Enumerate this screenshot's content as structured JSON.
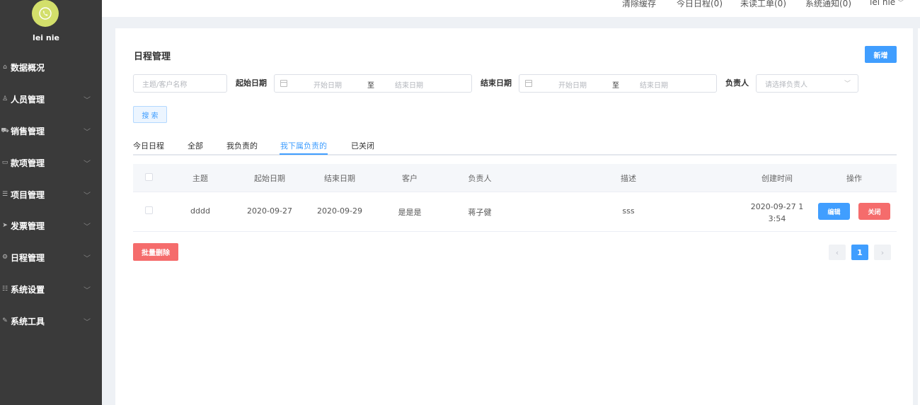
{
  "sidebar": {
    "username": "lei nie",
    "items": [
      {
        "label": "数据概况",
        "icon": "home-icon",
        "glyph": "⌂",
        "expandable": false
      },
      {
        "label": "人员管理",
        "icon": "user-icon",
        "glyph": "♙",
        "expandable": true
      },
      {
        "label": "销售管理",
        "icon": "cart-icon",
        "glyph": "⛟",
        "expandable": true
      },
      {
        "label": "款项管理",
        "icon": "money-icon",
        "glyph": "▭",
        "expandable": true
      },
      {
        "label": "项目管理",
        "icon": "database-icon",
        "glyph": "☰",
        "expandable": true
      },
      {
        "label": "发票管理",
        "icon": "send-icon",
        "glyph": "➤",
        "expandable": true
      },
      {
        "label": "日程管理",
        "icon": "gear-icon",
        "glyph": "⚙",
        "expandable": true
      },
      {
        "label": "系统设置",
        "icon": "users-icon",
        "glyph": "☷",
        "expandable": true
      },
      {
        "label": "系统工具",
        "icon": "wrench-icon",
        "glyph": "✎",
        "expandable": true
      }
    ]
  },
  "topbar": {
    "clear_cache": "清除缓存",
    "today_schedule": "今日日程(0)",
    "unread_orders": "未读工单(0)",
    "notifications": "系统通知(0)",
    "user": "lei nie"
  },
  "page": {
    "title": "日程管理",
    "add_button": "新增",
    "filters": {
      "subject_placeholder": "主题/客户名称",
      "start_date_label": "起始日期",
      "end_date_label": "结束日期",
      "range_start": "开始日期",
      "range_sep": "至",
      "range_end": "结束日期",
      "owner_label": "负责人",
      "owner_placeholder": "请选择负责人"
    },
    "search_button": "搜 索",
    "tabs": [
      "今日日程",
      "全部",
      "我负责的",
      "我下属负责的",
      "已关闭"
    ],
    "active_tab": "我下属负责的",
    "table": {
      "headers": [
        "主题",
        "起始日期",
        "结束日期",
        "客户",
        "负责人",
        "描述",
        "创建时间",
        "操作"
      ],
      "rows": [
        {
          "subject": "dddd",
          "start": "2020-09-27",
          "end": "2020-09-29",
          "customer": "是是是",
          "owner": "蒋子健",
          "desc": "sss",
          "created_line1": "2020-09-27 1",
          "created_line2": "3:54",
          "edit": "编辑",
          "close": "关闭"
        }
      ]
    },
    "batch_delete": "批量删除",
    "pagination": {
      "prev": "‹",
      "current": "1",
      "next": "›"
    }
  },
  "colors": {
    "primary": "#409eff",
    "danger": "#f56c6c",
    "sidebar": "#3a3a3a",
    "avatar": "#d3df6b"
  }
}
